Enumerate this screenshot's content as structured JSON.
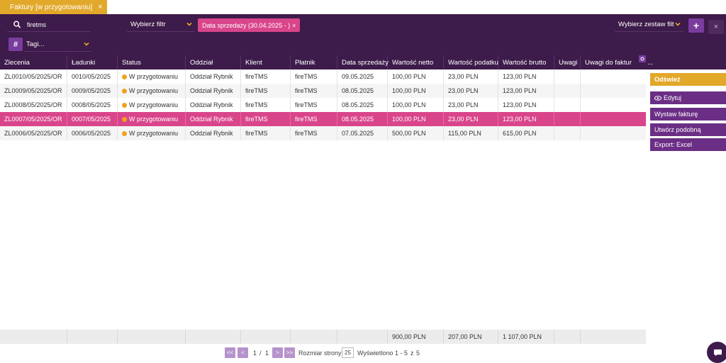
{
  "tab": {
    "label": "Faktury [w przygotowaniu]",
    "close": "×"
  },
  "filters": {
    "search_value": "firetms",
    "select_filter_placeholder": "Wybierz filtr",
    "active_filter": "Data sprzedaży (30.04.2025 - )",
    "active_filter_close": "×",
    "set_filter_placeholder": "Wybierz zestaw filt",
    "plus": "+",
    "close": "×",
    "tag_button": "#",
    "tags_placeholder": "Tagi..."
  },
  "columns": [
    "Zlecenia",
    "Ładunki",
    "Status",
    "Oddział",
    "Klient",
    "Płatnik",
    "Data sprzedaży",
    "Wartość netto",
    "Wartość podatku",
    "Wartość brutto",
    "Uwagi",
    "Uwagi do faktur"
  ],
  "header_more": "...",
  "rows": [
    {
      "zlecenia": "ZL0010/05/2025/OR",
      "ladunki": "0010/05/2025",
      "status": "W przygotowaniu",
      "oddzial": "Oddział Rybnik",
      "klient": "fireTMS",
      "platnik": "fireTMS",
      "data": "09.05.2025",
      "netto": "100,00 PLN",
      "podatek": "23,00 PLN",
      "brutto": "123,00 PLN",
      "uwagi": "",
      "uwagi_faktur": ""
    },
    {
      "zlecenia": "ZL0009/05/2025/OR",
      "ladunki": "0009/05/2025",
      "status": "W przygotowaniu",
      "oddzial": "Oddział Rybnik",
      "klient": "fireTMS",
      "platnik": "fireTMS",
      "data": "08.05.2025",
      "netto": "100,00 PLN",
      "podatek": "23,00 PLN",
      "brutto": "123,00 PLN",
      "uwagi": "",
      "uwagi_faktur": ""
    },
    {
      "zlecenia": "ZL0008/05/2025/OR",
      "ladunki": "0008/05/2025",
      "status": "W przygotowaniu",
      "oddzial": "Oddział Rybnik",
      "klient": "fireTMS",
      "platnik": "fireTMS",
      "data": "08.05.2025",
      "netto": "100,00 PLN",
      "podatek": "23,00 PLN",
      "brutto": "123,00 PLN",
      "uwagi": "",
      "uwagi_faktur": ""
    },
    {
      "zlecenia": "ZL0007/05/2025/OR",
      "ladunki": "0007/05/2025",
      "status": "W przygotowaniu",
      "oddzial": "Oddział Rybnik",
      "klient": "fireTMS",
      "platnik": "fireTMS",
      "data": "08.05.2025",
      "netto": "100,00 PLN",
      "podatek": "23,00 PLN",
      "brutto": "123,00 PLN",
      "uwagi": "",
      "uwagi_faktur": "",
      "selected": true
    },
    {
      "zlecenia": "ZL0006/05/2025/OR",
      "ladunki": "0006/05/2025",
      "status": "W przygotowaniu",
      "oddzial": "Oddział Rybnik",
      "klient": "fireTMS",
      "platnik": "fireTMS",
      "data": "07.05.2025",
      "netto": "500,00 PLN",
      "podatek": "115,00 PLN",
      "brutto": "615,00 PLN",
      "uwagi": "",
      "uwagi_faktur": ""
    }
  ],
  "totals": {
    "netto": "900,00 PLN",
    "podatek": "207,00 PLN",
    "brutto": "1 107,00 PLN"
  },
  "pager": {
    "first": "<<",
    "prev": "<",
    "page": "1",
    "sep": "/",
    "pages": "1",
    "next": ">",
    "last": ">>",
    "size_label": "Rozmiar strony:",
    "size_value": "25",
    "shown_label": "Wyświetlono",
    "shown_range": "1 - 5",
    "of_label": "z",
    "total": "5"
  },
  "actions": {
    "refresh": "Odśwież",
    "edit": "Edytuj",
    "invoice": "Wystaw fakturę",
    "similar": "Utwórz podobną",
    "export": "Export: Excel"
  },
  "colors": {
    "header": "#3d1b4a",
    "accent_pink": "#d9458b",
    "gold": "#e2a82a",
    "purple": "#6b2e85",
    "status_dot": "#f0a21f"
  }
}
